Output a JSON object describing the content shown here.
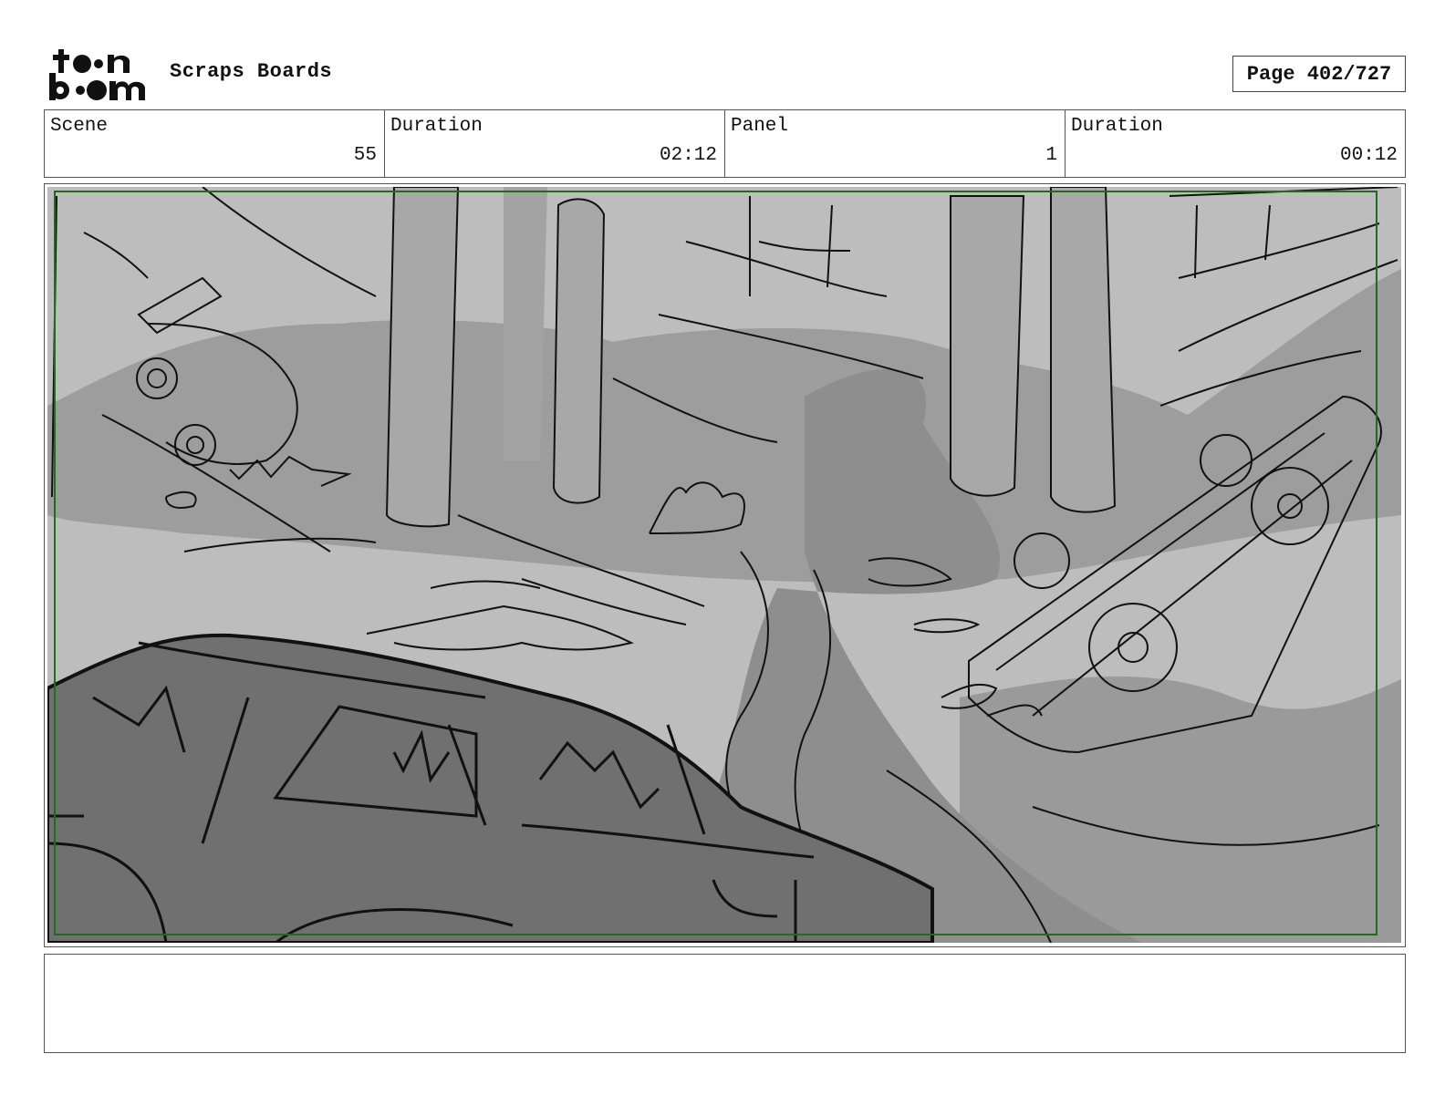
{
  "header": {
    "logo_name": "toon-boom-logo",
    "project_title": "Scraps Boards",
    "page_label": "Page 402/727"
  },
  "info": {
    "scene_label": "Scene",
    "scene_value": "55",
    "scene_duration_label": "Duration",
    "scene_duration_value": "02:12",
    "panel_label": "Panel",
    "panel_value": "1",
    "panel_duration_label": "Duration",
    "panel_duration_value": "00:12"
  },
  "notes": {
    "text": ""
  }
}
